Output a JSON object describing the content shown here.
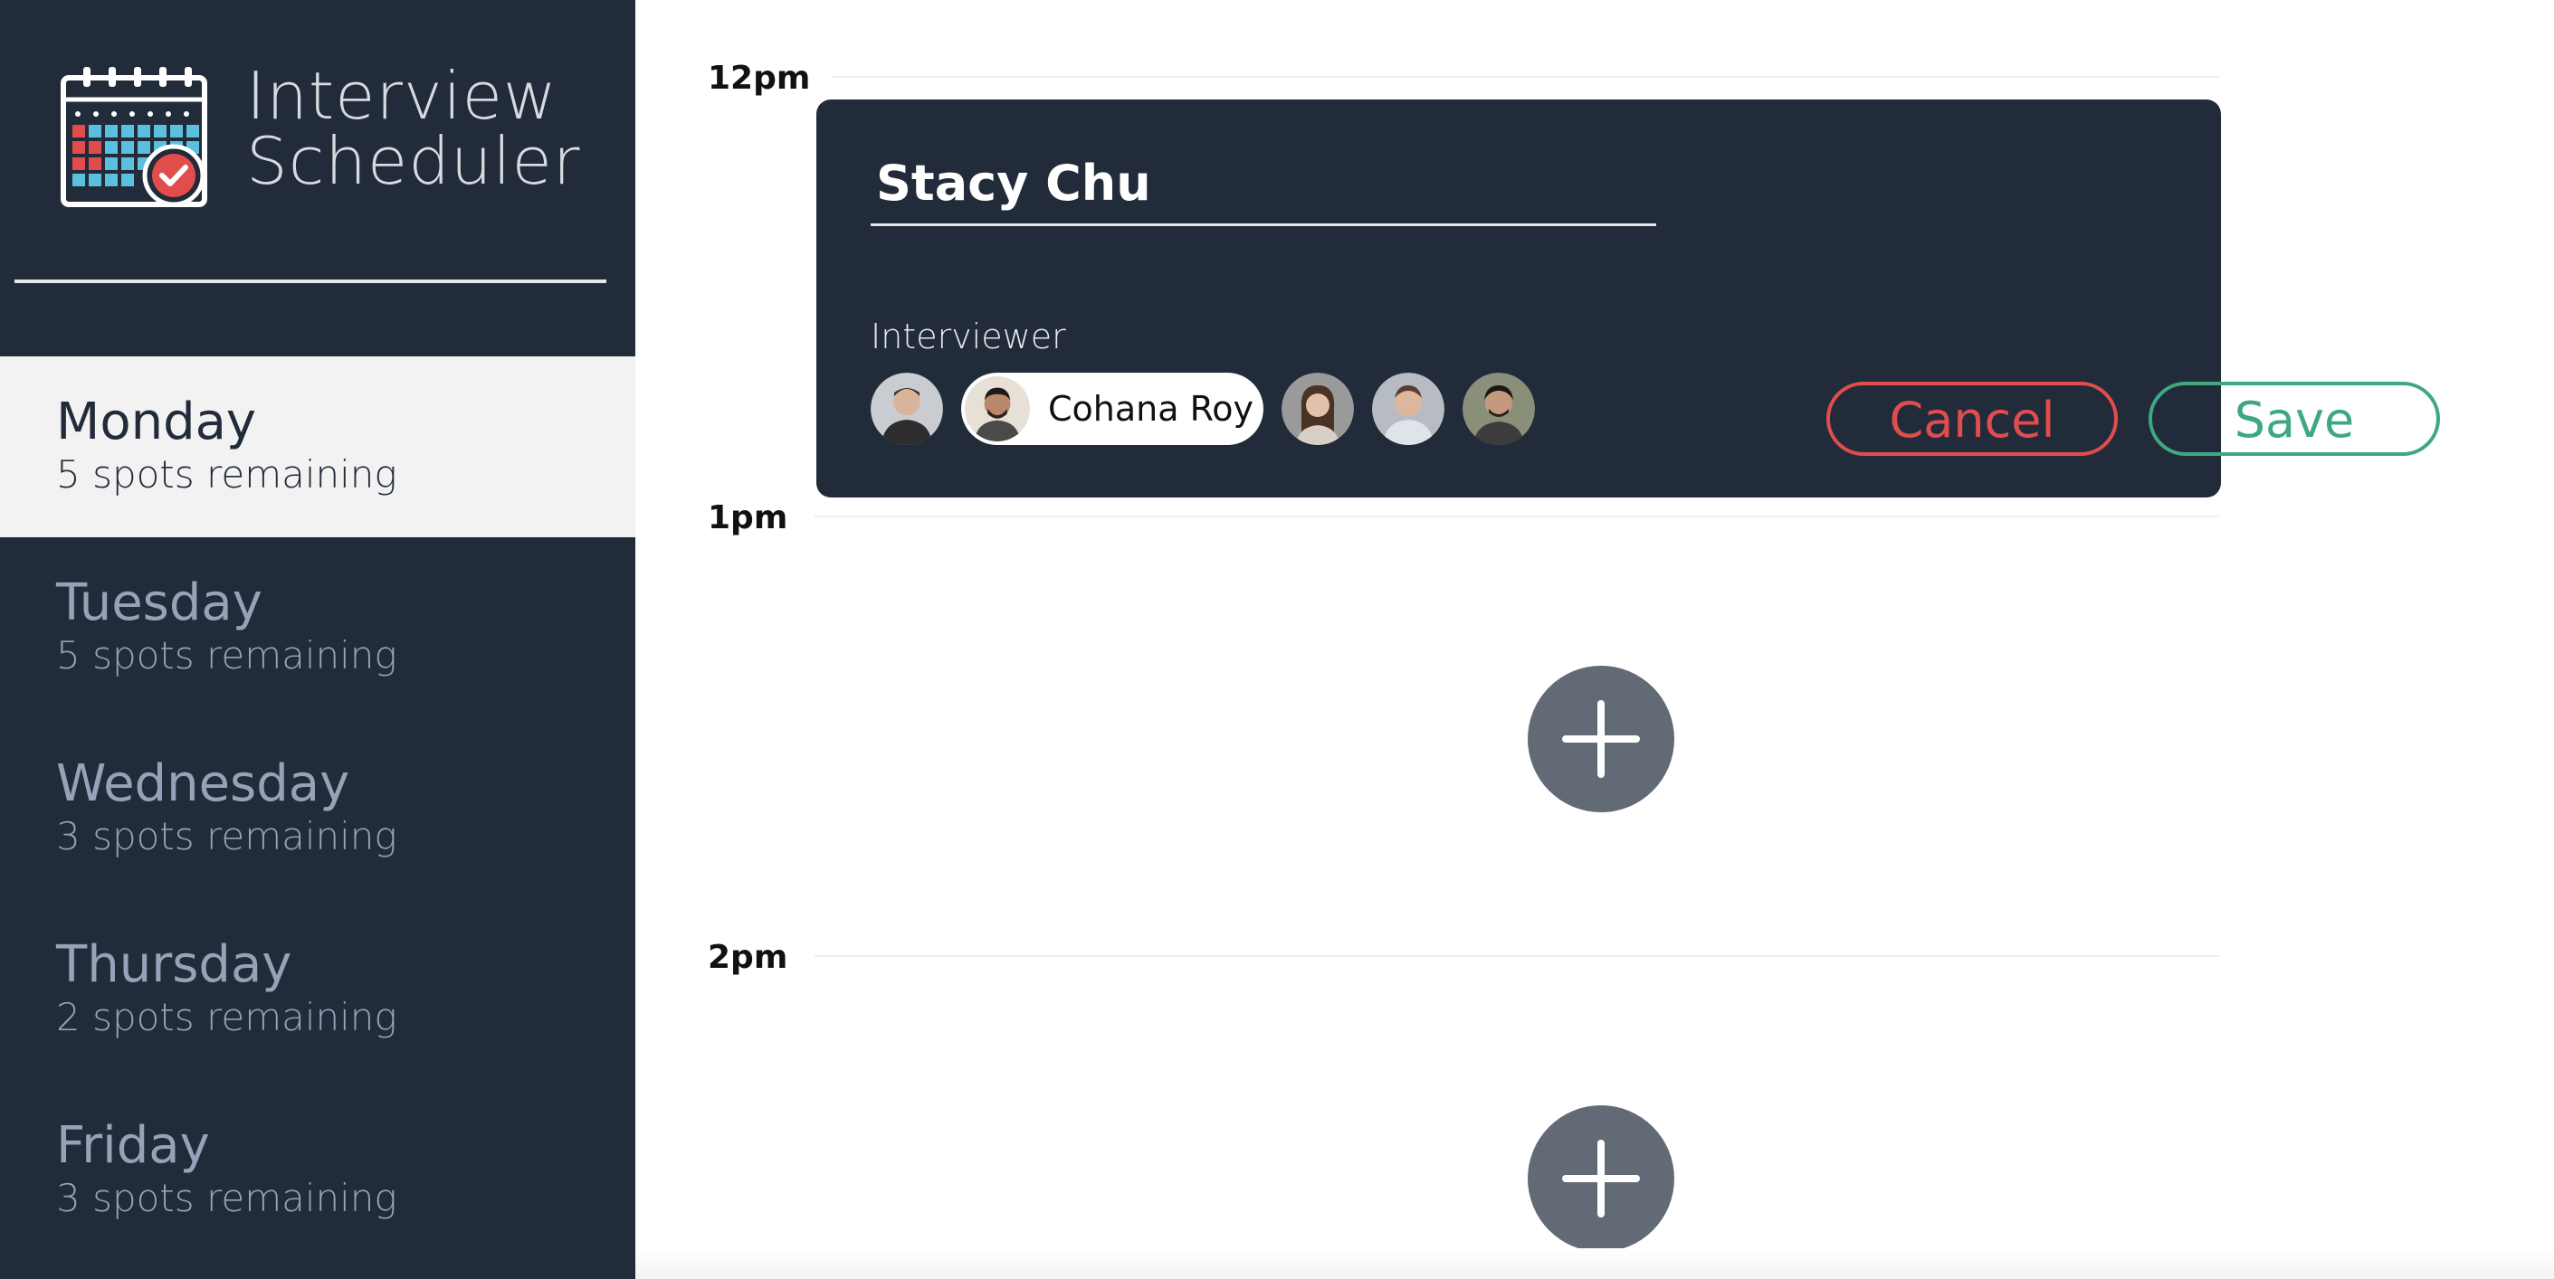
{
  "app": {
    "brand_line1": "Interview",
    "brand_line2": "Scheduler",
    "logo_icon": "calendar-check-icon"
  },
  "colors": {
    "sidebar_bg": "#222b3a",
    "selected_day_bg": "#f2f2f2",
    "muted_text": "#95a3b8",
    "cancel": "#e14d4d",
    "save": "#3fa883",
    "add_button": "#626a76"
  },
  "days": [
    {
      "name": "Monday",
      "spots": "5 spots remaining",
      "selected": true
    },
    {
      "name": "Tuesday",
      "spots": "5 spots remaining",
      "selected": false
    },
    {
      "name": "Wednesday",
      "spots": "3 spots remaining",
      "selected": false
    },
    {
      "name": "Thursday",
      "spots": "2 spots remaining",
      "selected": false
    },
    {
      "name": "Friday",
      "spots": "3 spots remaining",
      "selected": false
    }
  ],
  "schedule": {
    "times": [
      "12pm",
      "1pm",
      "2pm"
    ]
  },
  "form": {
    "student_name": "Stacy Chu",
    "interviewer_label": "Interviewer",
    "interviewers": [
      {
        "name": "",
        "selected": false,
        "avatar": "person-icon"
      },
      {
        "name": "Cohana Roy",
        "selected": true,
        "avatar": "person-icon"
      },
      {
        "name": "",
        "selected": false,
        "avatar": "person-icon"
      },
      {
        "name": "",
        "selected": false,
        "avatar": "person-icon"
      },
      {
        "name": "",
        "selected": false,
        "avatar": "person-icon"
      }
    ],
    "cancel_label": "Cancel",
    "save_label": "Save"
  },
  "add_icon": "plus-icon"
}
